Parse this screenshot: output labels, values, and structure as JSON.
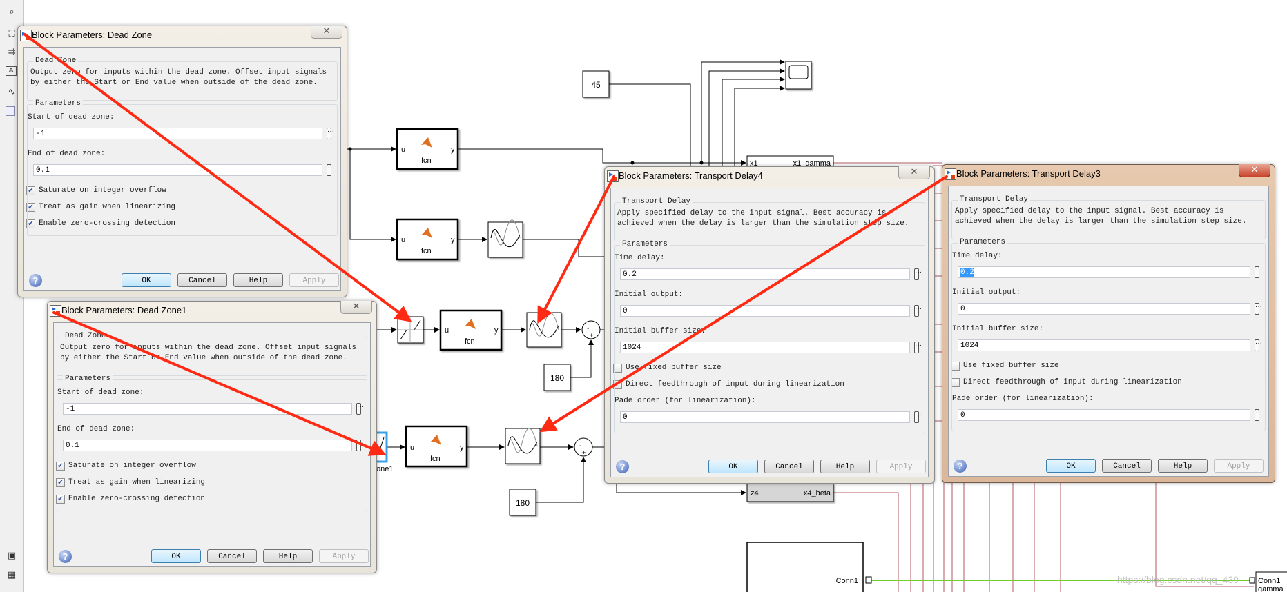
{
  "toolbar": {
    "icons": [
      "zoom-icon",
      "fit-view-icon",
      "arrow-icon",
      "annotation-icon",
      "image-icon",
      "area-icon",
      "camera-icon",
      "layout-icon"
    ]
  },
  "canvas": {
    "const_45": "45",
    "const_180_a": "180",
    "const_180_b": "180",
    "fcn_label": "fcn",
    "port_u": "u",
    "port_y": "y",
    "bus1_in": "x1",
    "bus1_out": "x1_gamma",
    "bus4_in": "z4",
    "bus4_out": "x4_beta",
    "deadzone1_label": "one1",
    "subsystem_port": "Conn1",
    "out_port1": "Conn1",
    "out_port2": "gamma",
    "colors": {
      "signal": "#000000",
      "physical": "#b05a63",
      "connection": "#6fcf2a",
      "annotation_arrow": "#ff2a14"
    }
  },
  "watermark": "https://blog.csdn.net/qq_439",
  "dialogs": [
    {
      "title": "Block Parameters: Dead Zone",
      "group": "Dead Zone",
      "description": [
        "Output zero for inputs within the dead zone.  Offset input signals",
        "by either the Start or End value when outside of the dead zone."
      ],
      "params_label": "Parameters",
      "controls": [
        {
          "type": "field",
          "label": "Start of dead zone:",
          "value": "-1"
        },
        {
          "type": "field",
          "label": "End of dead zone:",
          "value": "0.1"
        },
        {
          "type": "check",
          "label": "Saturate on integer overflow",
          "checked": true
        },
        {
          "type": "check",
          "label": "Treat as gain when linearizing",
          "checked": true
        },
        {
          "type": "check",
          "label": "Enable zero-crossing detection",
          "checked": true
        }
      ],
      "buttons": [
        "OK",
        "Cancel",
        "Help",
        "Apply"
      ],
      "active": false
    },
    {
      "title": "Block Parameters: Dead Zone1",
      "group": "Dead Zone",
      "description": [
        "Output zero for inputs within the dead zone.  Offset input signals",
        "by either the Start or End value when outside of the dead zone."
      ],
      "params_label": "Parameters",
      "controls": [
        {
          "type": "field",
          "label": "Start of dead zone:",
          "value": "-1"
        },
        {
          "type": "field",
          "label": "End of dead zone:",
          "value": "0.1"
        },
        {
          "type": "check",
          "label": "Saturate on integer overflow",
          "checked": true
        },
        {
          "type": "check",
          "label": "Treat as gain when linearizing",
          "checked": true
        },
        {
          "type": "check",
          "label": "Enable zero-crossing detection",
          "checked": true
        }
      ],
      "buttons": [
        "OK",
        "Cancel",
        "Help",
        "Apply"
      ],
      "active": false
    },
    {
      "title": "Block Parameters: Transport Delay4",
      "group": "Transport Delay",
      "description": [
        "Apply specified delay to the input signal.  Best accuracy is",
        "achieved when the delay is larger than the simulation step size."
      ],
      "params_label": "Parameters",
      "controls": [
        {
          "type": "field",
          "label": "Time delay:",
          "value": "0.2"
        },
        {
          "type": "field",
          "label": "Initial output:",
          "value": "0"
        },
        {
          "type": "field",
          "label": "Initial buffer size:",
          "value": "1024"
        },
        {
          "type": "check",
          "label": "Use fixed buffer size",
          "checked": false
        },
        {
          "type": "check",
          "label": "Direct feedthrough of input during linearization",
          "checked": false
        },
        {
          "type": "field",
          "label": "Pade order (for linearization):",
          "value": "0"
        }
      ],
      "buttons": [
        "OK",
        "Cancel",
        "Help",
        "Apply"
      ],
      "active": false
    },
    {
      "title": "Block Parameters: Transport Delay3",
      "group": "Transport Delay",
      "description": [
        "Apply specified delay to the input signal.  Best accuracy is",
        "achieved when the delay is larger than the simulation step size."
      ],
      "params_label": "Parameters",
      "controls": [
        {
          "type": "field",
          "label": "Time delay:",
          "value": "0.2",
          "selected": true
        },
        {
          "type": "field",
          "label": "Initial output:",
          "value": "0"
        },
        {
          "type": "field",
          "label": "Initial buffer size:",
          "value": "1024"
        },
        {
          "type": "check",
          "label": "Use fixed buffer size",
          "checked": false
        },
        {
          "type": "check",
          "label": "Direct feedthrough of input during linearization",
          "checked": false
        },
        {
          "type": "field",
          "label": "Pade order (for linearization):",
          "value": "0"
        }
      ],
      "buttons": [
        "OK",
        "Cancel",
        "Help",
        "Apply"
      ],
      "active": true
    }
  ]
}
